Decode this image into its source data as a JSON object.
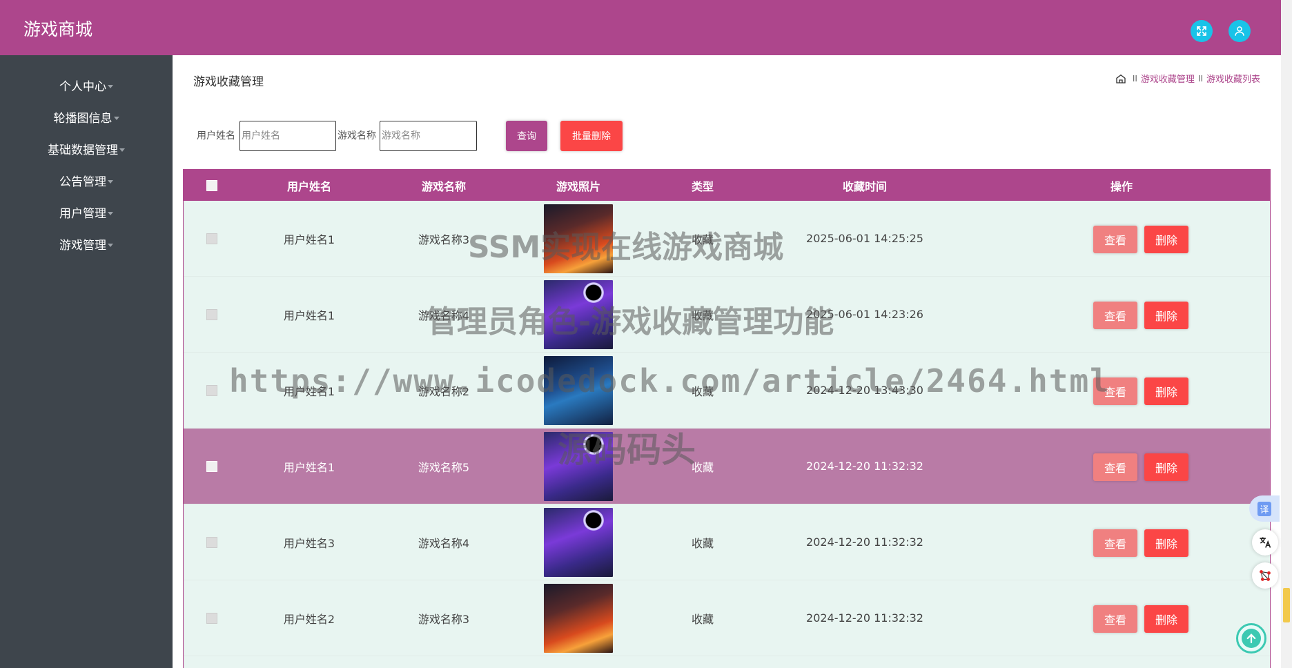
{
  "header": {
    "brand": "游戏商城",
    "fullscreen_icon": "fullscreen-icon",
    "user_icon": "user-icon",
    "color": "#ad468c"
  },
  "sidebar": {
    "items": [
      {
        "label": "个人中心"
      },
      {
        "label": "轮播图信息"
      },
      {
        "label": "基础数据管理"
      },
      {
        "label": "公告管理"
      },
      {
        "label": "用户管理"
      },
      {
        "label": "游戏管理"
      }
    ]
  },
  "page": {
    "title": "游戏收藏管理",
    "breadcrumb": [
      "游戏收藏管理",
      "游戏收藏列表"
    ],
    "breadcrumb_sep": "II"
  },
  "filters": {
    "user_label": "用户姓名",
    "user_placeholder": "用户姓名",
    "game_label": "游戏名称",
    "game_placeholder": "游戏名称",
    "query_button": "查询",
    "batch_delete_button": "批量删除"
  },
  "table": {
    "headers": [
      "用户姓名",
      "游戏名称",
      "游戏照片",
      "类型",
      "收藏时间",
      "操作"
    ],
    "view_label": "查看",
    "delete_label": "删除",
    "rows": [
      {
        "user": "用户姓名1",
        "game": "游戏名称3",
        "type": "收藏",
        "time": "2025-06-01 14:25:25",
        "thumb": "fire"
      },
      {
        "user": "用户姓名1",
        "game": "游戏名称4",
        "type": "收藏",
        "time": "2025-06-01 14:23:26",
        "thumb": "purple"
      },
      {
        "user": "用户姓名1",
        "game": "游戏名称2",
        "type": "收藏",
        "time": "2024-12-20 13:43:30",
        "thumb": "blue"
      },
      {
        "user": "用户姓名1",
        "game": "游戏名称5",
        "type": "收藏",
        "time": "2024-12-20 11:32:32",
        "thumb": "purple"
      },
      {
        "user": "用户姓名3",
        "game": "游戏名称4",
        "type": "收藏",
        "time": "2024-12-20 11:32:32",
        "thumb": "purple"
      },
      {
        "user": "用户姓名2",
        "game": "游戏名称3",
        "type": "收藏",
        "time": "2024-12-20 11:32:32",
        "thumb": "fire"
      }
    ]
  },
  "watermark": {
    "line1": "SSM实现在线游戏商城",
    "line2": "管理员角色-游戏收藏管理功能",
    "line3": "https://www.icodedock.com/article/2464.html",
    "line4": "源码码头"
  },
  "floating": {
    "translate_label": "译",
    "ai_icon": "translate-ai-icon",
    "network_icon": "network-icon",
    "back_top_icon": "arrow-up-icon"
  }
}
